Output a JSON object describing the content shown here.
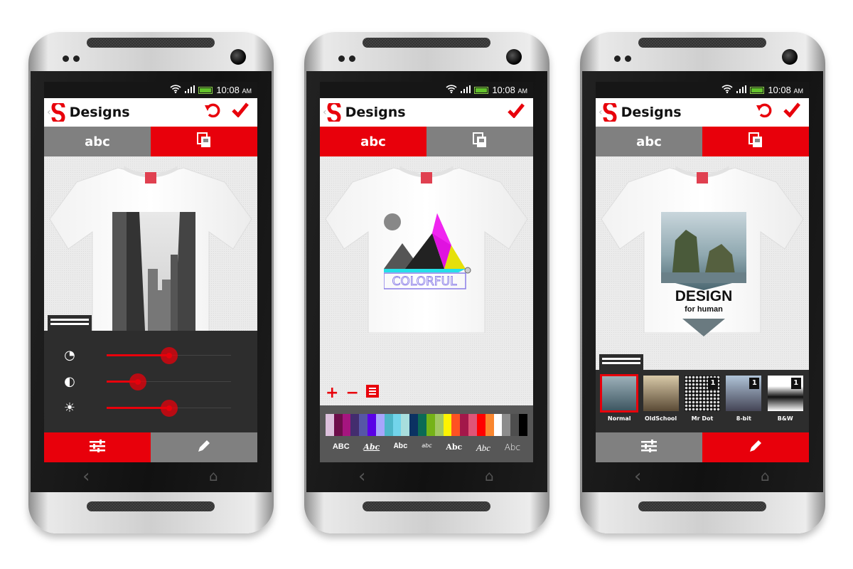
{
  "colors": {
    "accent": "#e8000b",
    "inactive": "#808080",
    "panel": "#2d2d2d"
  },
  "status": {
    "time": "10:08",
    "ampm": "AM",
    "icons": [
      "wifi-icon",
      "signal-icon",
      "battery-icon"
    ]
  },
  "header": {
    "title": "Designs",
    "back": "‹"
  },
  "tabs": {
    "text": "abc"
  },
  "phones": [
    {
      "active_tab": "image",
      "show_undo": true,
      "mode": "adjust",
      "sliders": [
        {
          "name": "saturation",
          "icon": "saturation-icon",
          "value": 0.5
        },
        {
          "name": "contrast",
          "icon": "contrast-icon",
          "value": 0.25
        },
        {
          "name": "brightness",
          "icon": "brightness-icon",
          "value": 0.5
        }
      ],
      "bottom_active": "adjust"
    },
    {
      "active_tab": "text",
      "show_undo": false,
      "mode": "text",
      "design_text": "COLORFUL",
      "palette": [
        "#dcc0dc",
        "#6d0d4a",
        "#a5157f",
        "#432d6e",
        "#5656a6",
        "#5a00e6",
        "#a7a5fb",
        "#4db6c8",
        "#72d4ea",
        "#a8dedd",
        "#0b3262",
        "#0b6a55",
        "#75b317",
        "#a2c862",
        "#fdf302",
        "#ff5222",
        "#a3174a",
        "#df5577",
        "#ff0000",
        "#f9862f",
        "#ffffff",
        "#8d8d8d",
        "#4e4e4e",
        "#000000"
      ],
      "fonts": [
        "ABC",
        "Abc",
        "Abc",
        "abc",
        "Abc",
        "Abc",
        "Abc"
      ]
    },
    {
      "active_tab": "image",
      "show_undo": true,
      "mode": "filters",
      "design_text": "DESIGN",
      "design_sub": "for human",
      "filters": [
        {
          "label": "Normal",
          "selected": true
        },
        {
          "label": "OldSchool"
        },
        {
          "label": "Mr Dot",
          "badge": "1"
        },
        {
          "label": "8-bit",
          "badge": "1"
        },
        {
          "label": "B&W",
          "badge": "1"
        }
      ],
      "bottom_active": "edit"
    }
  ]
}
